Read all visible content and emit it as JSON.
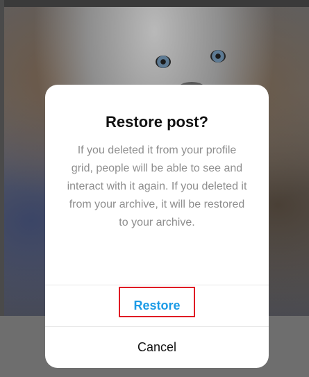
{
  "dialog": {
    "title": "Restore post?",
    "message": "If you deleted it from your profile grid, people will be able to see and interact with it again. If you deleted it from your archive, it will be restored to your archive.",
    "restore_label": "Restore",
    "cancel_label": "Cancel"
  },
  "colors": {
    "restore_accent": "#1c9be6",
    "highlight": "#e01b24"
  }
}
